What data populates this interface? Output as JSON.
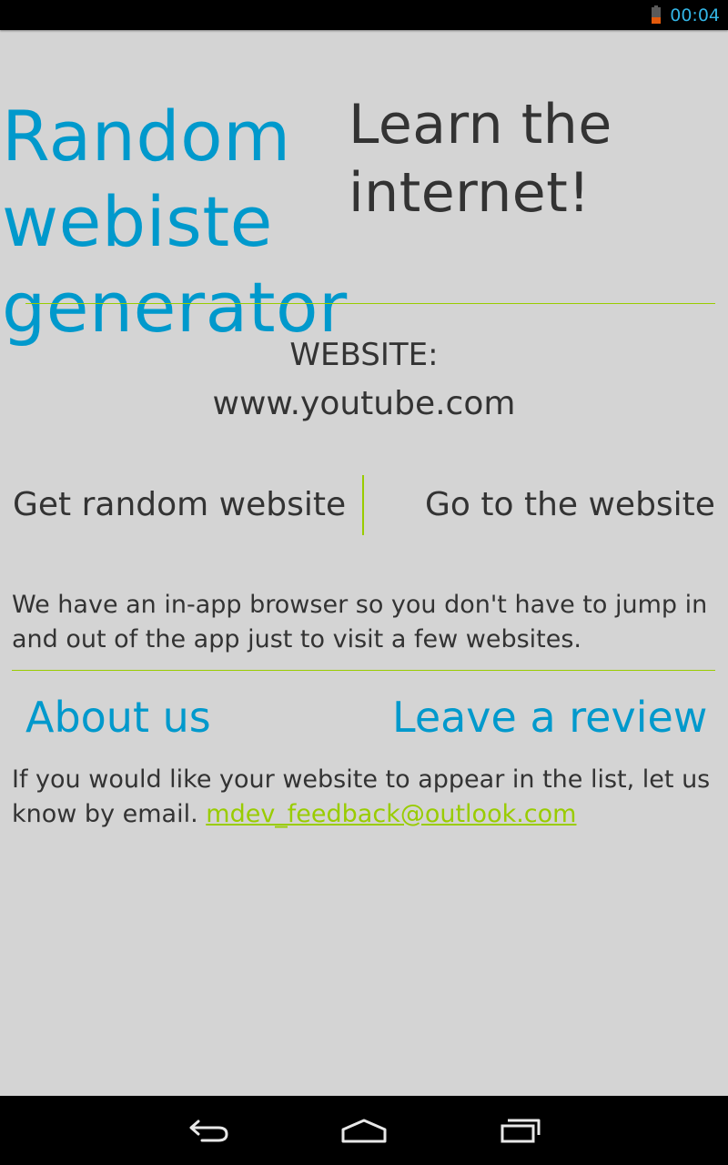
{
  "status_bar": {
    "time": "00:04",
    "icons": [
      "battery-low-icon"
    ]
  },
  "header": {
    "title": "Random webiste generator",
    "tagline": "Learn the internet!"
  },
  "website": {
    "label": "WEBSITE:",
    "value": "www.youtube.com"
  },
  "actions": {
    "random_label": "Get random website",
    "goto_label": "Go to the website"
  },
  "info": {
    "text": "We have an in-app browser so you don't have to jump in and out of the app just to visit a few websites."
  },
  "links": {
    "about_label": "About us",
    "review_label": "Leave a review"
  },
  "contact": {
    "text": "If you would like your website to appear in the list, let us know by email. ",
    "email": "mdev_feedback@outlook.com"
  },
  "nav_bar": {
    "icons": [
      "back-icon",
      "home-icon",
      "recent-apps-icon"
    ]
  },
  "colors": {
    "title": "#0099cc",
    "accent": "#99cc00",
    "text": "#333333",
    "background": "#d4d4d4",
    "status_clock": "#33b5e5"
  }
}
